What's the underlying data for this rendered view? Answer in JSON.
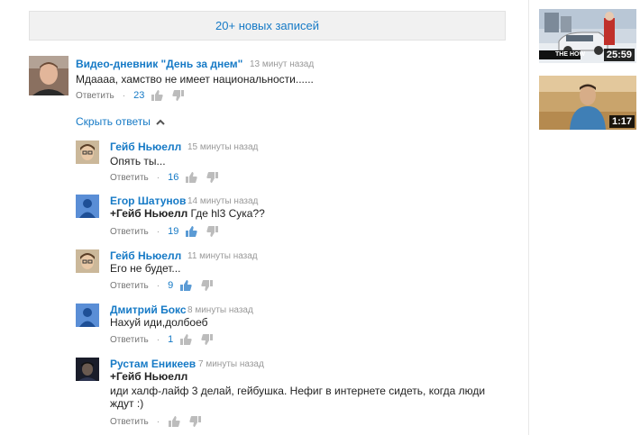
{
  "new_posts_label": "20+ новых записей",
  "top_comment": {
    "author": "Видео-дневник \"День за днем\"",
    "time": "13 минут назад",
    "text": "Мдаааа, хамство не имеет национальности......",
    "reply_label": "Ответить",
    "likes": "23"
  },
  "hide_replies_label": "Скрыть ответы",
  "replies": [
    {
      "author": "Гейб Ньюелл",
      "time": "15 минуты назад",
      "mention": "",
      "text": "Опять ты...",
      "text2": "",
      "reply_label": "Ответить",
      "likes": "16"
    },
    {
      "author": "Егор Шатунов",
      "time": "14 минуты назад",
      "mention": "+Гейб Ньюелл",
      "text": " Где hl3 Сука??",
      "text2": "",
      "reply_label": "Ответить",
      "likes": "19"
    },
    {
      "author": "Гейб Ньюелл",
      "time": "11 минуты назад",
      "mention": "",
      "text": "Его не будет...",
      "text2": "",
      "reply_label": "Ответить",
      "likes": "9"
    },
    {
      "author": "Дмитрий Бокс",
      "time": "8 минуты назад",
      "mention": "",
      "text": "Нахуй иди,долбоеб",
      "text2": "",
      "reply_label": "Ответить",
      "likes": "1"
    },
    {
      "author": "Рустам Еникеев",
      "time": "7 минуты назад",
      "mention": "+Гейб Ньюелл",
      "text": "иди халф-лайф 3 делай, гейбушка. Нефиг в интернете сидеть, когда люди",
      "text2": "ждут :)",
      "reply_label": "Ответить",
      "likes": ""
    }
  ],
  "videos": [
    {
      "duration": "25:59",
      "brand": "THE HOW"
    },
    {
      "duration": "1:17"
    }
  ],
  "icons": {
    "like": "thumbs-up-icon",
    "dislike": "thumbs-down-icon",
    "chevron": "chevron-up-icon"
  },
  "colors": {
    "link": "#167ac6",
    "muted": "#999999",
    "like_active": "#5b9bd5",
    "icon_gray": "#bcbcbc"
  }
}
